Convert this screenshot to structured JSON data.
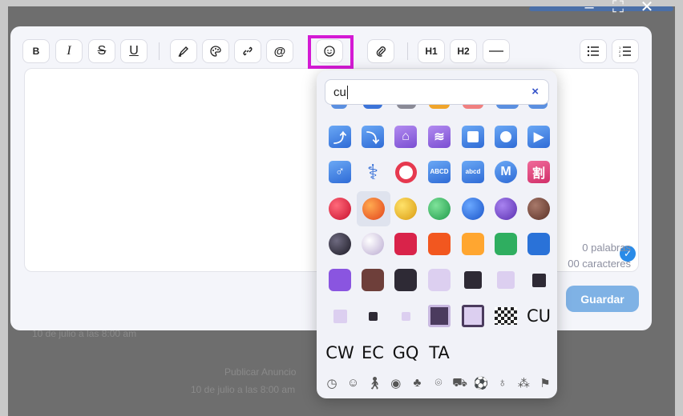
{
  "background": {
    "blurred_text_1": "Publicar Anuncio",
    "blurred_text_2": "10 de julio a las 8:00 am",
    "blurred_text_3": "10 de julio a las 8:00 am"
  },
  "window_controls": {
    "minimize_icon": "minimize-icon",
    "maximize_icon": "maximize-icon",
    "close_icon": "close-icon"
  },
  "toolbar": {
    "bold": "B",
    "italic": "I",
    "strike": "S",
    "underline": "U",
    "h1": "H1",
    "h2": "H2",
    "highlight_icon": "highlighter-icon",
    "color_icon": "palette-icon",
    "link_icon": "link-icon",
    "mention_icon": "at-icon",
    "emoji_icon": "smiley-icon",
    "attach_icon": "paperclip-icon",
    "hr_icon": "horizontal-rule-icon",
    "bullet_icon": "bulleted-list-icon",
    "ordered_icon": "numbered-list-icon"
  },
  "editor": {
    "words": "0 palabras",
    "chars": "00 caracteres",
    "save_label": "Guardar"
  },
  "emoji_picker": {
    "search_value": "cu",
    "clear_label": "×",
    "flag_letters": [
      "CU",
      "CW",
      "EC",
      "GQ",
      "TA"
    ],
    "tiles": {
      "abcd_upper": "ABCD",
      "abcd_lower": "abcd",
      "m_letter": "M",
      "kanji": "割",
      "male": "♂",
      "medical": "⚕"
    },
    "categories": [
      "recent-icon",
      "smileys-icon",
      "people-icon",
      "animals-icon",
      "nature-icon",
      "food-icon",
      "travel-icon",
      "activities-icon",
      "objects-icon",
      "symbols-icon",
      "flags-icon"
    ]
  },
  "colors": {
    "accent_highlight": "#d41ad4",
    "save_button": "#7fb2e5",
    "check": "#2a8be8"
  }
}
